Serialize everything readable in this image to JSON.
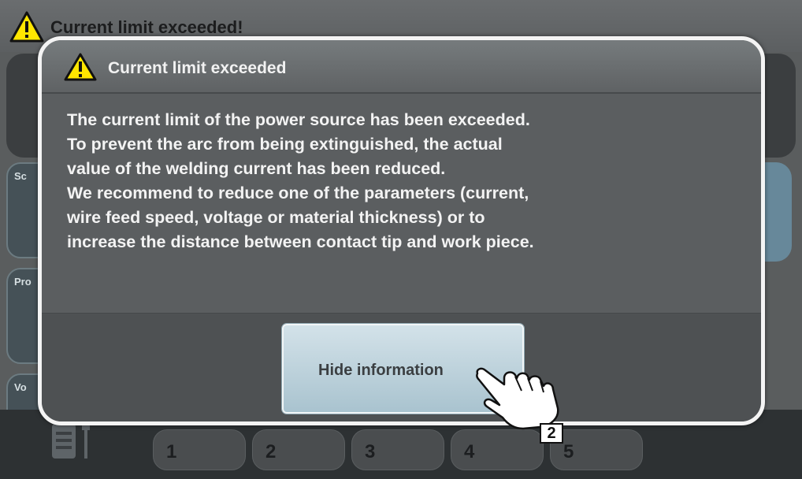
{
  "window": {
    "title": "Current limit exceeded!",
    "side_buttons": [
      {
        "label": "Sc"
      },
      {
        "label": "Pro"
      },
      {
        "label": "Vo"
      }
    ],
    "tabs": [
      "1",
      "2",
      "3",
      "4",
      "5"
    ]
  },
  "dialog": {
    "title": "Current limit exceeded",
    "message_lines": [
      "The current limit of the power source has been exceeded.",
      "To prevent the arc from being extinguished, the actual",
      "value of the welding current has been reduced.",
      "We recommend to reduce one of the parameters (current,",
      "wire feed speed, voltage or material thickness) or to",
      "increase the distance between contact tip and work piece."
    ],
    "hide_button_label": "Hide information"
  },
  "callout": {
    "step_number": "2"
  },
  "icons": {
    "warning": "warning-triangle-icon",
    "tool": "welding-tool-icon",
    "hand": "pointing-hand-icon"
  },
  "colors": {
    "warning_yellow": "#ffe600",
    "dialog_border": "#f4f4f4",
    "button_fill": "#c1d5de"
  }
}
